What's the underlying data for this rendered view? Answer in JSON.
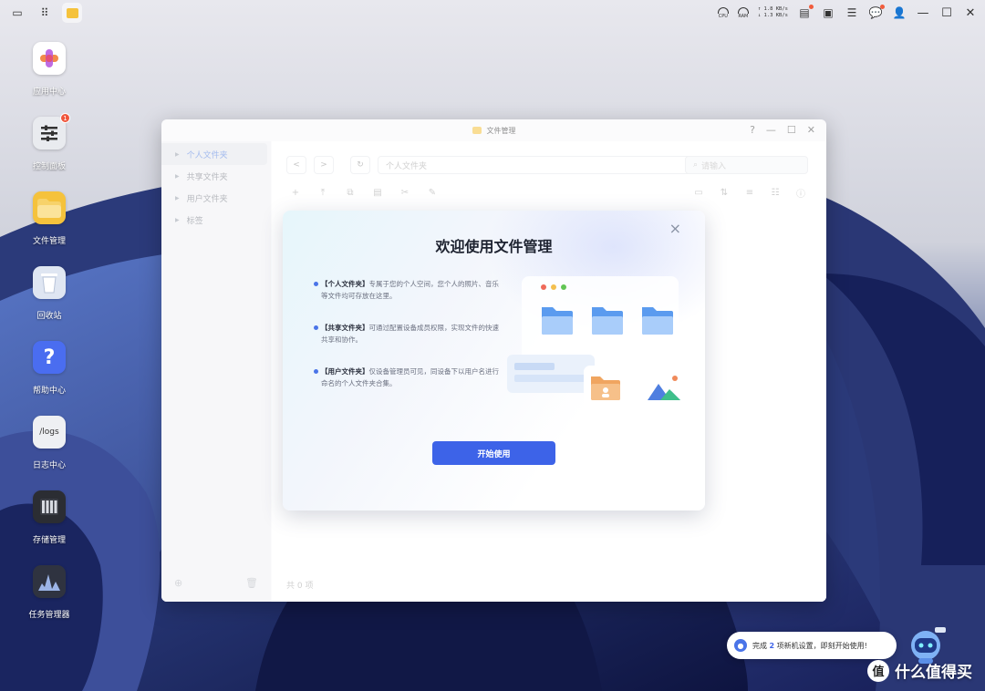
{
  "topbar": {
    "cpu_label": "CPU",
    "ram_label": "RAM",
    "upload_speed": "↑ 1.8 KB/s",
    "download_speed": "↓ 1.3 KB/s"
  },
  "desktop": {
    "icons": [
      {
        "label": "应用中心",
        "icon": "app-center-icon"
      },
      {
        "label": "控制面板",
        "icon": "control-panel-icon",
        "badge": "1"
      },
      {
        "label": "文件管理",
        "icon": "folder-icon"
      },
      {
        "label": "回收站",
        "icon": "trash-icon"
      },
      {
        "label": "帮助中心",
        "icon": "help-icon"
      },
      {
        "label": "日志中心",
        "icon": "logs-icon",
        "glyph": "/logs"
      },
      {
        "label": "存储管理",
        "icon": "storage-icon"
      },
      {
        "label": "任务管理器",
        "icon": "task-manager-icon"
      }
    ]
  },
  "file_manager": {
    "title": "文件管理",
    "help": "?",
    "sidebar": [
      {
        "label": "个人文件夹",
        "selected": true
      },
      {
        "label": "共享文件夹",
        "selected": false
      },
      {
        "label": "用户文件夹",
        "selected": false
      },
      {
        "label": "标签",
        "selected": false
      }
    ],
    "path_placeholder": "个人文件夹",
    "search_placeholder": "请输入",
    "item_count": "共 0 项"
  },
  "welcome": {
    "title": "欢迎使用文件管理",
    "bullets": [
      {
        "tag": "【个人文件夹】",
        "text": "专属于您的个人空间，您个人的照片、音乐等文件均可存放在这里。"
      },
      {
        "tag": "【共享文件夹】",
        "text": "可通过配置设备成员权限，实现文件的快速共享和协作。"
      },
      {
        "tag": "【用户文件夹】",
        "text": "仅设备管理员可见，同设备下以用户名进行命名的个人文件夹合集。"
      }
    ],
    "button": "开始使用",
    "close": "×"
  },
  "toast": {
    "prefix": "完成",
    "count": "2",
    "suffix": "项新机设置，即刻开始使用!"
  },
  "watermark": {
    "logo": "值",
    "text": "什么值得买"
  },
  "colors": {
    "accent": "#3d63e8",
    "folder": "#f5c23c",
    "badge": "#f0553b"
  }
}
